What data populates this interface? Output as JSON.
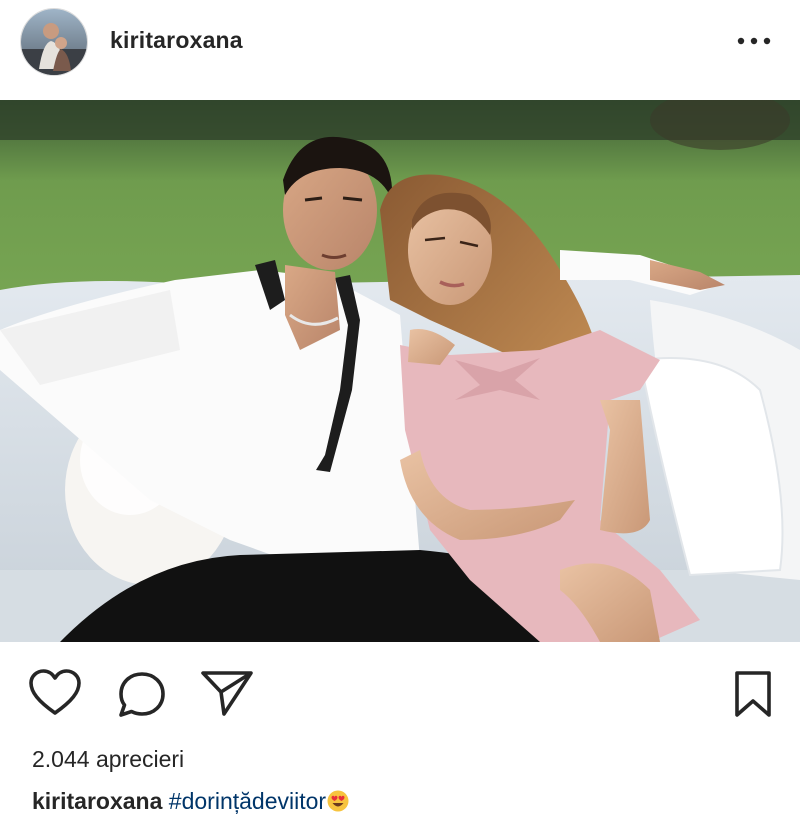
{
  "header": {
    "username": "kiritaroxana",
    "avatar_icon": "profile-photo",
    "more_icon": "more-options-icon"
  },
  "post": {
    "image_alt": "couple-portrait-photo",
    "likes_text": "2.044 aprecieri",
    "caption": {
      "username": "kiritaroxana",
      "hashtag": "#dorințădeviitor",
      "emoji": "heart-eyes-emoji"
    }
  },
  "actions": {
    "like_icon": "heart-icon",
    "comment_icon": "comment-icon",
    "share_icon": "share-icon",
    "save_icon": "bookmark-icon"
  },
  "colors": {
    "text": "#262626",
    "hashtag": "#003569",
    "background": "#ffffff"
  }
}
